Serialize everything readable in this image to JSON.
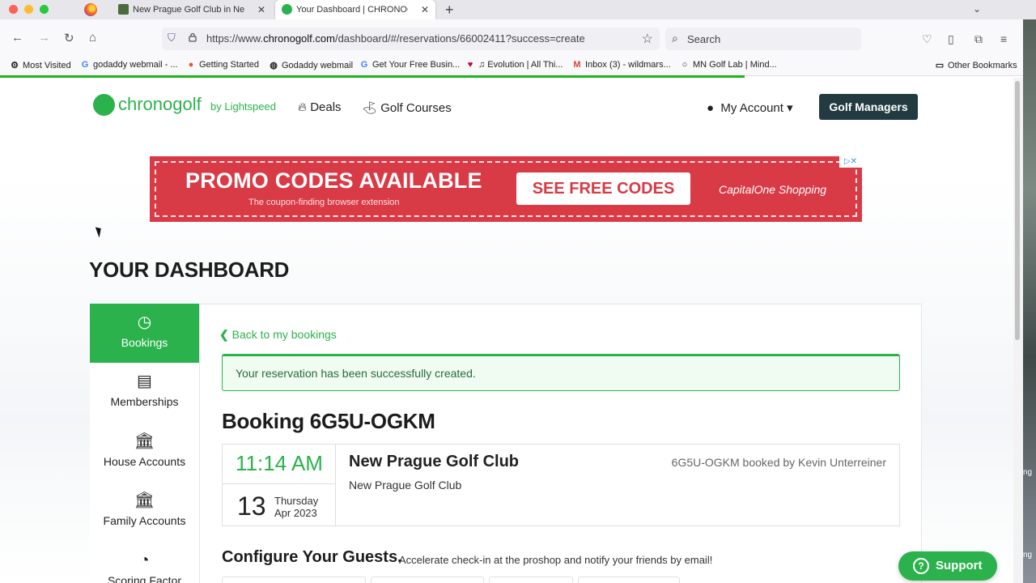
{
  "browser": {
    "tabs": [
      {
        "title": "New Prague Golf Club in New Prague",
        "active": false
      },
      {
        "title": "Your Dashboard | CHRONOGOLF",
        "active": true
      }
    ],
    "new_tab_icon": "plus-icon",
    "url": {
      "prefix": "https://www.",
      "domain": "chronogolf.com",
      "path": "/dashboard/#/reservations/66002411?success=create"
    },
    "search_placeholder": "Search",
    "bookmarks": [
      {
        "label": "Most Visited",
        "icon": "gear-icon"
      },
      {
        "label": "godaddy webmail - ...",
        "icon": "google-icon"
      },
      {
        "label": "Getting Started",
        "icon": "firefox-icon"
      },
      {
        "label": "Godaddy webmail",
        "icon": "globe-icon"
      },
      {
        "label": "Get Your Free Busin...",
        "icon": "google-icon"
      },
      {
        "label": "♫ Evolution | All Thi...",
        "icon": "iheart-icon"
      },
      {
        "label": "Inbox (3) - wildmars...",
        "icon": "gmail-icon"
      },
      {
        "label": "MN Golf Lab | Mind...",
        "icon": "circle-icon"
      }
    ],
    "other_bookmarks": "Other Bookmarks",
    "colors": {
      "load_bar": "#1db41d"
    }
  },
  "site": {
    "logo": {
      "word": "chronogolf",
      "by": "by Lightspeed"
    },
    "nav": [
      {
        "label": "Deals",
        "icon": "flame-icon"
      },
      {
        "label": "Golf Courses",
        "icon": "golf-flag-icon"
      }
    ],
    "account_label": "My Account",
    "managers_label": "Golf Managers",
    "colors": {
      "brand_green": "#2bb24c",
      "managers_bg": "#233b40"
    }
  },
  "ad": {
    "headline": "PROMO CODES AVAILABLE",
    "subline": "The coupon-finding browser extension",
    "cta": "SEE FREE CODES",
    "brand": "CapitalOne Shopping"
  },
  "dashboard": {
    "title": "YOUR DASHBOARD",
    "sidebar": [
      {
        "label": "Bookings",
        "icon": "clock-icon",
        "active": true
      },
      {
        "label": "Memberships",
        "icon": "id-card-icon",
        "active": false
      },
      {
        "label": "House Accounts",
        "icon": "bank-icon",
        "active": false
      },
      {
        "label": "Family Accounts",
        "icon": "family-bank-icon",
        "active": false
      },
      {
        "label": "Scoring Factor",
        "icon": "gauge-icon",
        "active": false
      }
    ],
    "back_label": "Back to my bookings",
    "success_message": "Your reservation has been successfully created.",
    "booking": {
      "title": "Booking 6G5U-OGKM",
      "time": "11:14 AM",
      "day": "13",
      "weekday": "Thursday",
      "month_year": "Apr 2023",
      "club": "New Prague Golf Club",
      "club_sub": "New Prague Golf Club",
      "booked_by": "6G5U-OGKM booked by Kevin Unterreiner"
    },
    "guests": {
      "title": "Configure Your Guests.",
      "subtitle": "Accelerate check-in at the proshop and notify your friends by email!"
    }
  },
  "support_label": "Support"
}
